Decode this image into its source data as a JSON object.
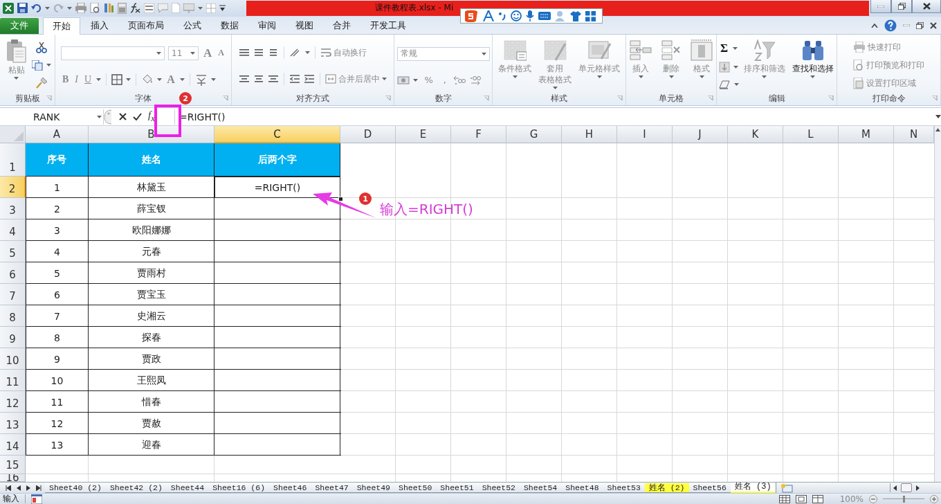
{
  "window": {
    "title": "课件教程表.xlsx - Mi"
  },
  "ribbon_tabs": [
    {
      "label": "文件",
      "kind": "file",
      "selected": false
    },
    {
      "label": "开始",
      "kind": "tab",
      "selected": true
    },
    {
      "label": "插入",
      "kind": "tab",
      "selected": false
    },
    {
      "label": "页面布局",
      "kind": "tab",
      "selected": false
    },
    {
      "label": "公式",
      "kind": "tab",
      "selected": false
    },
    {
      "label": "数据",
      "kind": "tab",
      "selected": false
    },
    {
      "label": "审阅",
      "kind": "tab",
      "selected": false
    },
    {
      "label": "视图",
      "kind": "tab",
      "selected": false
    },
    {
      "label": "合并",
      "kind": "tab",
      "selected": false
    },
    {
      "label": "开发工具",
      "kind": "tab",
      "selected": false
    }
  ],
  "ribbon_groups": [
    {
      "title": "剪贴板",
      "items": [
        {
          "label": "粘贴",
          "kind": "large",
          "disabled": true
        }
      ]
    },
    {
      "title": "字体",
      "items": [
        {
          "label": "11",
          "kind": "size",
          "disabled": true
        },
        {
          "label": "A",
          "kind": "grow",
          "disabled": true
        },
        {
          "label": "A",
          "kind": "shrink",
          "disabled": true
        },
        {
          "label": "B",
          "kind": "bold",
          "disabled": true
        },
        {
          "label": "I",
          "kind": "italic",
          "disabled": true
        },
        {
          "label": "U",
          "kind": "underline",
          "disabled": true
        },
        {
          "label": "A",
          "kind": "color",
          "disabled": true
        }
      ]
    },
    {
      "title": "对齐方式",
      "items": [
        {
          "label": "自动换行",
          "kind": "small",
          "disabled": true
        },
        {
          "label": "合并后居中",
          "kind": "small",
          "disabled": true
        }
      ]
    },
    {
      "title": "数字",
      "items": [
        {
          "label": "常规",
          "kind": "format",
          "disabled": true
        },
        {
          "label": "%",
          "kind": "glyph",
          "disabled": true
        },
        {
          "label": ",",
          "kind": "glyph",
          "disabled": true
        }
      ]
    },
    {
      "title": "样式",
      "items": [
        {
          "lines": [
            "条件格式"
          ],
          "kind": "large",
          "disabled": true
        },
        {
          "lines": [
            "套用",
            "表格格式"
          ],
          "kind": "large",
          "disabled": true
        },
        {
          "lines": [
            "单元格样式"
          ],
          "kind": "large",
          "disabled": true
        }
      ]
    },
    {
      "title": "单元格",
      "items": [
        {
          "lines": [
            "插入"
          ],
          "kind": "large",
          "disabled": true
        },
        {
          "lines": [
            "删除"
          ],
          "kind": "large",
          "disabled": true
        },
        {
          "lines": [
            "格式"
          ],
          "kind": "large",
          "disabled": true
        }
      ]
    },
    {
      "title": "编辑",
      "items": [
        {
          "label": "Σ",
          "kind": "sum",
          "disabled": false
        },
        {
          "lines": [
            "排序和筛选"
          ],
          "kind": "large",
          "disabled": true
        },
        {
          "lines": [
            "查找和选择"
          ],
          "kind": "large",
          "disabled": false
        }
      ]
    },
    {
      "title": "打印命令",
      "items": [
        {
          "label": "快速打印",
          "kind": "small",
          "disabled": true
        },
        {
          "label": "打印预览和打印",
          "kind": "small",
          "disabled": true
        },
        {
          "label": "设置打印区域",
          "kind": "small",
          "disabled": true
        }
      ]
    }
  ],
  "formula_bar": {
    "name_box": "RANK",
    "fx": "f$_{x}$",
    "formula": "=RIGHT()"
  },
  "sheet": {
    "columns": [
      {
        "label": "A",
        "selected": false
      },
      {
        "label": "B",
        "selected": false
      },
      {
        "label": "C",
        "selected": true
      },
      {
        "label": "D",
        "selected": false
      },
      {
        "label": "E",
        "selected": false
      },
      {
        "label": "F",
        "selected": false
      },
      {
        "label": "G",
        "selected": false
      },
      {
        "label": "H",
        "selected": false
      },
      {
        "label": "I",
        "selected": false
      },
      {
        "label": "J",
        "selected": false
      },
      {
        "label": "K",
        "selected": false
      },
      {
        "label": "L",
        "selected": false
      },
      {
        "label": "M",
        "selected": false
      },
      {
        "label": "N",
        "selected": false
      }
    ],
    "rows": [
      {
        "label": "1",
        "selected": false
      },
      {
        "label": "2",
        "selected": true
      },
      {
        "label": "3",
        "selected": false
      },
      {
        "label": "4",
        "selected": false
      },
      {
        "label": "5",
        "selected": false
      },
      {
        "label": "6",
        "selected": false
      },
      {
        "label": "7",
        "selected": false
      },
      {
        "label": "8",
        "selected": false
      },
      {
        "label": "9",
        "selected": false
      },
      {
        "label": "10",
        "selected": false
      },
      {
        "label": "11",
        "selected": false
      },
      {
        "label": "12",
        "selected": false
      },
      {
        "label": "13",
        "selected": false
      },
      {
        "label": "14",
        "selected": false
      },
      {
        "label": "15",
        "selected": false
      },
      {
        "label": "16",
        "selected": false
      }
    ],
    "table": {
      "header": [
        "序号",
        "姓名",
        "后两个字"
      ],
      "rows": [
        {
          "number": "1",
          "name": "林黛玉",
          "result": "=RIGHT()"
        },
        {
          "number": "2",
          "name": "薛宝钗"
        },
        {
          "number": "3",
          "name": "欧阳娜娜"
        },
        {
          "number": "4",
          "name": "元春"
        },
        {
          "number": "5",
          "name": "贾雨村"
        },
        {
          "number": "6",
          "name": "贾宝玉"
        },
        {
          "number": "7",
          "name": "史湘云"
        },
        {
          "number": "8",
          "name": "探春"
        },
        {
          "number": "9",
          "name": "贾政"
        },
        {
          "number": "10",
          "name": "王熙凤"
        },
        {
          "number": "11",
          "name": "惜春"
        },
        {
          "number": "12",
          "name": "贾赦"
        },
        {
          "number": "13",
          "name": "迎春"
        }
      ]
    }
  },
  "annotations": [
    {
      "number": "1",
      "text": "输入=RIGHT()"
    },
    {
      "number": "2"
    }
  ],
  "sheet_tabs": [
    {
      "label": "Sheet40 (2)",
      "selected": false
    },
    {
      "label": "Sheet42 (2)",
      "selected": false
    },
    {
      "label": "Sheet44",
      "selected": false
    },
    {
      "label": "Sheet16 (6)",
      "selected": false
    },
    {
      "label": "Sheet46",
      "selected": false
    },
    {
      "label": "Sheet47",
      "selected": false
    },
    {
      "label": "Sheet49",
      "selected": false
    },
    {
      "label": "Sheet50",
      "selected": false
    },
    {
      "label": "Sheet51",
      "selected": false
    },
    {
      "label": "Sheet52",
      "selected": false
    },
    {
      "label": "Sheet54",
      "selected": false
    },
    {
      "label": "Sheet48",
      "selected": false
    },
    {
      "label": "Sheet53",
      "selected": false
    },
    {
      "label": "姓名 (2)",
      "selected": false,
      "color": "#ffff40"
    },
    {
      "label": "Sheet56",
      "selected": false
    },
    {
      "label": "姓名 (3)",
      "selected": true,
      "color": "#ffff40"
    }
  ],
  "status_bar": {
    "mode": "输入",
    "zoom": "100%",
    "zoom_slider": {
      "level": 0.5
    }
  }
}
